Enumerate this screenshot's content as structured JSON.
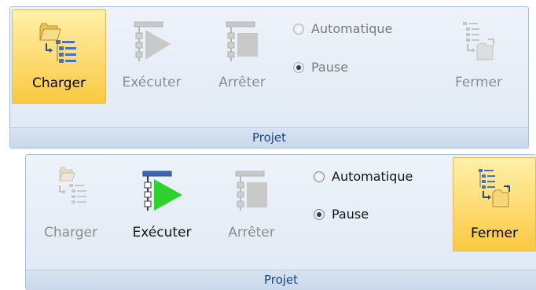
{
  "panels": [
    {
      "group_label": "Projet",
      "buttons": {
        "charger": {
          "label": "Charger",
          "state": "active"
        },
        "executer": {
          "label": "Exécuter",
          "state": "disabled"
        },
        "arreter": {
          "label": "Arrêter",
          "state": "disabled"
        },
        "fermer": {
          "label": "Fermer",
          "state": "disabled"
        }
      },
      "mode": {
        "options": [
          "Automatique",
          "Pause"
        ],
        "selected": "Pause",
        "enabled": false
      }
    },
    {
      "group_label": "Projet",
      "buttons": {
        "charger": {
          "label": "Charger",
          "state": "disabled"
        },
        "executer": {
          "label": "Exécuter",
          "state": "enabled"
        },
        "arreter": {
          "label": "Arrêter",
          "state": "disabled"
        },
        "fermer": {
          "label": "Fermer",
          "state": "active"
        }
      },
      "mode": {
        "options": [
          "Automatique",
          "Pause"
        ],
        "selected": "Pause",
        "enabled": true
      }
    }
  ],
  "icons": [
    "open-folder-icon",
    "tree-list-icon",
    "play-icon",
    "stop-icon",
    "close-folder-icon"
  ],
  "colors": {
    "active_fill": "#fdd96b",
    "play_green": "#2fd12f",
    "tree_blue": "#4a72b8",
    "group_label_text": "#15428b"
  }
}
